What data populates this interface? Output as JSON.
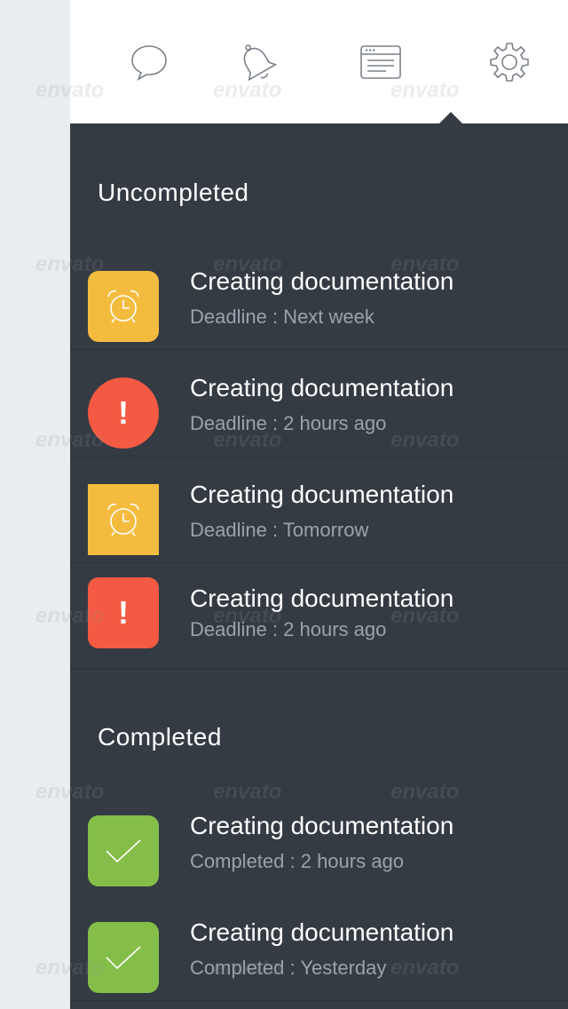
{
  "colors": {
    "panel_bg": "#343b43",
    "topbar_bg": "#ffffff",
    "warning": "#f4bc3f",
    "danger": "#f45a43",
    "success": "#84be48"
  },
  "nav": {
    "items": [
      {
        "icon": "chat-bubble-icon"
      },
      {
        "icon": "bell-icon"
      },
      {
        "icon": "browser-window-icon",
        "active": true
      },
      {
        "icon": "gear-icon"
      }
    ]
  },
  "sections": {
    "uncompleted": {
      "title": "Uncompleted",
      "items": [
        {
          "title": "Creating documentation",
          "subtitle": "Deadline : Next week",
          "icon": "alarm-clock-icon",
          "status": "warning"
        },
        {
          "title": "Creating documentation",
          "subtitle": "Deadline : 2 hours ago",
          "icon": "exclamation-icon",
          "status": "danger"
        },
        {
          "title": "Creating documentation",
          "subtitle": "Deadline : Tomorrow",
          "icon": "alarm-clock-icon",
          "status": "warning"
        },
        {
          "title": "Creating documentation",
          "subtitle": "Deadline : 2 hours ago",
          "icon": "exclamation-icon",
          "status": "danger"
        }
      ]
    },
    "completed": {
      "title": "Completed",
      "items": [
        {
          "title": "Creating documentation",
          "subtitle": "Completed : 2 hours ago",
          "icon": "checkmark-icon",
          "status": "success"
        },
        {
          "title": "Creating documentation",
          "subtitle": "Completed : Yesterday",
          "icon": "checkmark-icon",
          "status": "success"
        }
      ]
    }
  },
  "watermark_text": "envato",
  "exclamation_mark": "!"
}
